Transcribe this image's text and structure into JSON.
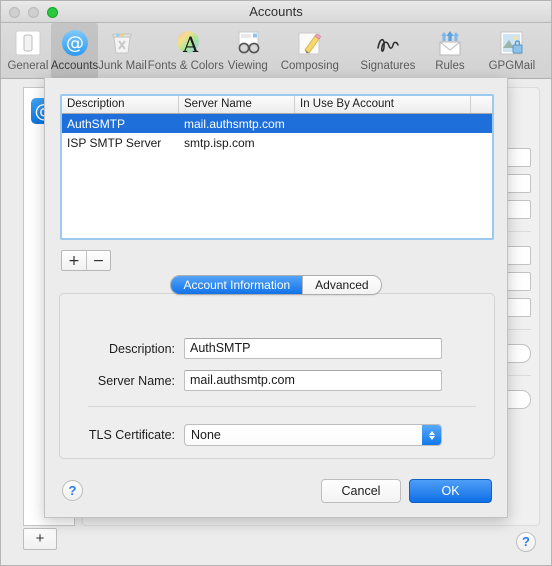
{
  "window": {
    "title": "Accounts",
    "traffic_lights": [
      "close",
      "minimize",
      "zoom"
    ]
  },
  "toolbar": {
    "items": [
      {
        "label": "General",
        "icon": "general-icon"
      },
      {
        "label": "Accounts",
        "icon": "accounts-at-icon"
      },
      {
        "label": "Junk Mail",
        "icon": "junk-mail-trash-icon"
      },
      {
        "label": "Fonts & Colors",
        "icon": "fonts-colors-icon"
      },
      {
        "label": "Viewing",
        "icon": "viewing-glasses-icon"
      },
      {
        "label": "Composing",
        "icon": "composing-pencil-icon"
      },
      {
        "label": "Signatures",
        "icon": "signatures-script-icon"
      },
      {
        "label": "Rules",
        "icon": "rules-envelope-icon"
      },
      {
        "label": "GPGMail",
        "icon": "gpgmail-lock-icon"
      }
    ],
    "selected": "Accounts"
  },
  "sheet": {
    "table": {
      "columns": [
        "Description",
        "Server Name",
        "In Use By Account",
        ""
      ],
      "rows": [
        {
          "description": "AuthSMTP",
          "server_name": "mail.authsmtp.com",
          "in_use_by_account": "",
          "extra": "",
          "selected": true
        },
        {
          "description": "ISP SMTP Server",
          "server_name": "smtp.isp.com",
          "in_use_by_account": "",
          "extra": "",
          "selected": false
        }
      ]
    },
    "add_remove": {
      "add_label": "+",
      "remove_label": "−"
    },
    "tabs": [
      {
        "label": "Account Information",
        "active": true
      },
      {
        "label": "Advanced",
        "active": false
      }
    ],
    "form": {
      "description_label": "Description:",
      "description_value": "AuthSMTP",
      "server_name_label": "Server Name:",
      "server_name_value": "mail.authsmtp.com",
      "tls_label": "TLS Certificate:",
      "tls_value": "None"
    },
    "footer": {
      "help_label": "?",
      "cancel_label": "Cancel",
      "ok_label": "OK"
    }
  },
  "background_window": {
    "account_icon": "@",
    "add_account_label": "+",
    "help_label": "?"
  },
  "colors": {
    "selection_blue": "#1e6fd9",
    "accent_blue": "#1178ea",
    "window_bg": "#ececec",
    "zoom_green": "#28c93f"
  }
}
